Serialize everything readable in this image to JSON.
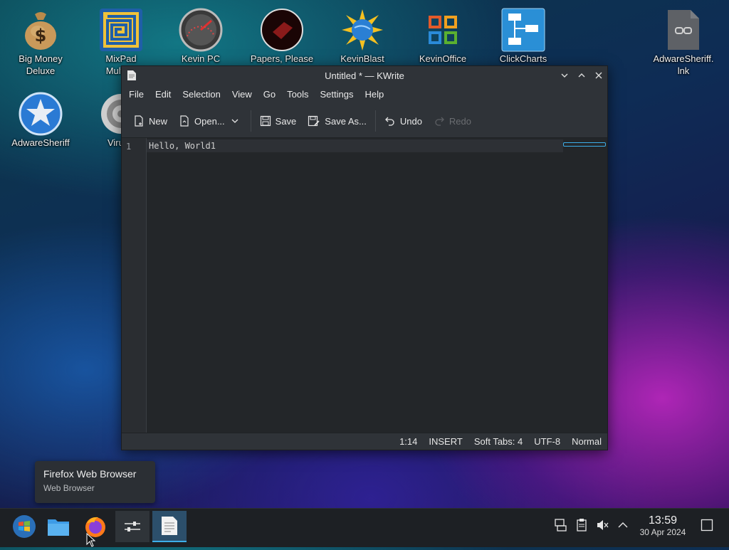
{
  "desktop": {
    "icons": [
      {
        "label": "Big Money\nDeluxe",
        "icon": "money-bag-icon"
      },
      {
        "label": "MixPad\nMultitra",
        "icon": "mixpad-icon"
      },
      {
        "label": "Kevin PC",
        "icon": "speedometer-icon"
      },
      {
        "label": "Papers, Please",
        "icon": "papers-please-icon"
      },
      {
        "label": "KevinBlast",
        "icon": "globe-burst-icon"
      },
      {
        "label": "KevinOffice",
        "icon": "office-icon"
      },
      {
        "label": "ClickCharts",
        "icon": "flowchart-icon"
      },
      {
        "label": "AdwareSheriff.\nlnk",
        "icon": "link-file-icon"
      },
      {
        "label": "AdwareSheriff",
        "icon": "sheriff-badge-icon"
      },
      {
        "label": "VirusB",
        "icon": "target-icon"
      }
    ]
  },
  "window": {
    "title": "Untitled * — KWrite",
    "menu": [
      "File",
      "Edit",
      "Selection",
      "View",
      "Go",
      "Tools",
      "Settings",
      "Help"
    ],
    "toolbar": {
      "new": "New",
      "open": "Open...",
      "save": "Save",
      "save_as": "Save As...",
      "undo": "Undo",
      "redo": "Redo"
    },
    "editor": {
      "line_number": "1",
      "content": "Hello, World1"
    },
    "status": {
      "position": "1:14",
      "mode": "INSERT",
      "tabs": "Soft Tabs: 4",
      "encoding": "UTF-8",
      "syntax": "Normal"
    }
  },
  "tooltip": {
    "title": "Firefox Web Browser",
    "subtitle": "Web Browser"
  },
  "taskbar": {
    "time": "13:59",
    "date": "30 Apr 2024"
  },
  "colors": {
    "accent": "#3daee9",
    "window_bg": "#2a2e32",
    "editor_bg": "#232629"
  }
}
